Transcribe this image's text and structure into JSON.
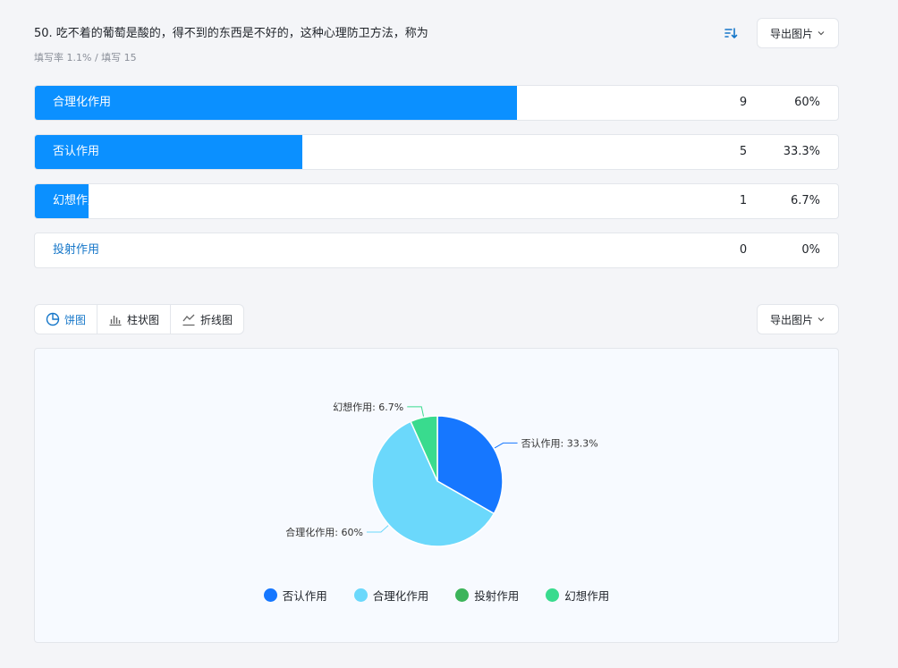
{
  "question": {
    "title": "50. 吃不着的葡萄是酸的，得不到的东西是不好的，这种心理防卫方法，称为",
    "meta": "填写率 1.1% / 填写 15"
  },
  "toolbar": {
    "export_label": "导出图片",
    "sort_icon": "sort-icon"
  },
  "options": [
    {
      "label": "合理化作用",
      "count": "9",
      "percent": "60%",
      "ratio": 0.6
    },
    {
      "label": "否认作用",
      "count": "5",
      "percent": "33.3%",
      "ratio": 0.333
    },
    {
      "label": "幻想作用",
      "count": "1",
      "percent": "6.7%",
      "ratio": 0.067
    },
    {
      "label": "投射作用",
      "count": "0",
      "percent": "0%",
      "ratio": 0
    }
  ],
  "chart_tabs": [
    {
      "label": "饼图",
      "icon": "pie-chart-icon",
      "active": true
    },
    {
      "label": "柱状图",
      "icon": "bar-chart-icon",
      "active": false
    },
    {
      "label": "折线图",
      "icon": "line-chart-icon",
      "active": false
    }
  ],
  "colors": {
    "bar_fill": "#0b90ff",
    "accent": "#1677c9"
  },
  "chart_data": {
    "type": "pie",
    "series": [
      {
        "name": "否认作用",
        "value": 33.3,
        "color": "#1677ff"
      },
      {
        "name": "合理化作用",
        "value": 60,
        "color": "#6bd8fb"
      },
      {
        "name": "投射作用",
        "value": 0,
        "color": "#3cb45a"
      },
      {
        "name": "幻想作用",
        "value": 6.7,
        "color": "#39db8e"
      }
    ],
    "labels": [
      {
        "name": "否认作用",
        "text": "否认作用: 33.3%"
      },
      {
        "name": "合理化作用",
        "text": "合理化作用: 60%"
      },
      {
        "name": "幻想作用",
        "text": "幻想作用: 6.7%"
      }
    ],
    "legend_position": "bottom"
  }
}
